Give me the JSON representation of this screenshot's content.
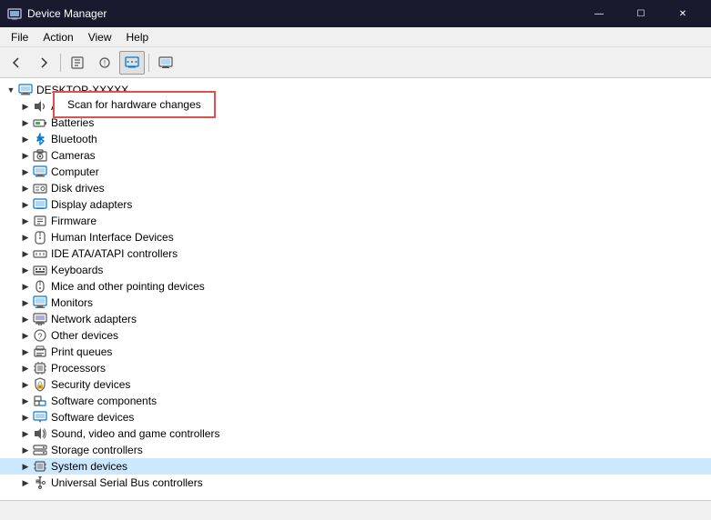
{
  "window": {
    "title": "Device Manager",
    "title_icon": "⚙",
    "controls": {
      "minimize": "—",
      "maximize": "☐",
      "close": "✕"
    }
  },
  "menubar": {
    "items": [
      "File",
      "Action",
      "View",
      "Help"
    ]
  },
  "toolbar": {
    "buttons": [
      "←",
      "→",
      "⊞",
      "⊟",
      "⊕",
      "⊗",
      "🖥"
    ]
  },
  "tooltip": {
    "text": "Scan for hardware changes"
  },
  "tree": {
    "root": "DESKTOP-XXXXX",
    "items": [
      {
        "label": "A...",
        "indent": 2,
        "expander": "▶",
        "icon": "speaker"
      },
      {
        "label": "Batteries",
        "indent": 2,
        "expander": "▶",
        "icon": "battery"
      },
      {
        "label": "Bluetooth",
        "indent": 2,
        "expander": "▶",
        "icon": "bluetooth"
      },
      {
        "label": "Cameras",
        "indent": 2,
        "expander": "▶",
        "icon": "camera"
      },
      {
        "label": "Computer",
        "indent": 2,
        "expander": "▶",
        "icon": "computer"
      },
      {
        "label": "Disk drives",
        "indent": 2,
        "expander": "▶",
        "icon": "disk"
      },
      {
        "label": "Display adapters",
        "indent": 2,
        "expander": "▶",
        "icon": "display"
      },
      {
        "label": "Firmware",
        "indent": 2,
        "expander": "▶",
        "icon": "firmware"
      },
      {
        "label": "Human Interface Devices",
        "indent": 2,
        "expander": "▶",
        "icon": "hid"
      },
      {
        "label": "IDE ATA/ATAPI controllers",
        "indent": 2,
        "expander": "▶",
        "icon": "ide"
      },
      {
        "label": "Keyboards",
        "indent": 2,
        "expander": "▶",
        "icon": "keyboard"
      },
      {
        "label": "Mice and other pointing devices",
        "indent": 2,
        "expander": "▶",
        "icon": "mouse"
      },
      {
        "label": "Monitors",
        "indent": 2,
        "expander": "▶",
        "icon": "monitor"
      },
      {
        "label": "Network adapters",
        "indent": 2,
        "expander": "▶",
        "icon": "network"
      },
      {
        "label": "Other devices",
        "indent": 2,
        "expander": "▶",
        "icon": "other"
      },
      {
        "label": "Print queues",
        "indent": 2,
        "expander": "▶",
        "icon": "print"
      },
      {
        "label": "Processors",
        "indent": 2,
        "expander": "▶",
        "icon": "cpu"
      },
      {
        "label": "Security devices",
        "indent": 2,
        "expander": "▶",
        "icon": "security"
      },
      {
        "label": "Software components",
        "indent": 2,
        "expander": "▶",
        "icon": "software"
      },
      {
        "label": "Software devices",
        "indent": 2,
        "expander": "▶",
        "icon": "softdev"
      },
      {
        "label": "Sound, video and game controllers",
        "indent": 2,
        "expander": "▶",
        "icon": "sound"
      },
      {
        "label": "Storage controllers",
        "indent": 2,
        "expander": "▶",
        "icon": "storage"
      },
      {
        "label": "System devices",
        "indent": 2,
        "expander": "▶",
        "icon": "system"
      },
      {
        "label": "Universal Serial Bus controllers",
        "indent": 2,
        "expander": "▶",
        "icon": "usb"
      }
    ]
  },
  "status": {
    "text": ""
  },
  "colors": {
    "titlebar": "#1a1a2e",
    "accent": "#0078d4",
    "tooltip_border": "#e05050"
  }
}
